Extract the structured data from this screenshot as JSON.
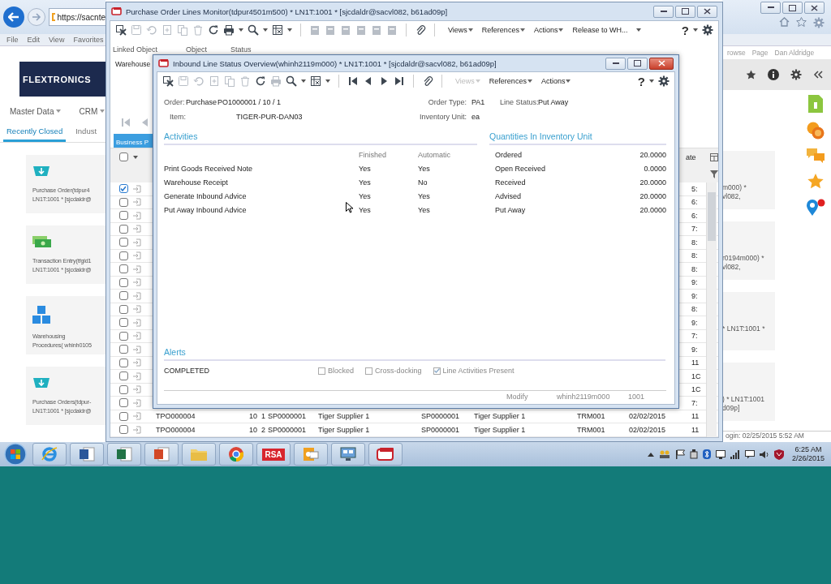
{
  "browser": {
    "address": "https://sacnte",
    "menu": [
      "File",
      "Edit",
      "View",
      "Favorites"
    ],
    "logo": "FLEXTRONICS",
    "nav": [
      "Master Data",
      "CRM"
    ],
    "tabs": [
      {
        "label": "Recently Closed",
        "selected": true
      },
      {
        "label": "Indust",
        "selected": false
      }
    ],
    "cards": [
      {
        "kind": "tray",
        "lines": [
          "Purchase Order(tdpur4",
          "LN1T:1001 * [sjcdaldr@"
        ]
      },
      {
        "kind": "cash",
        "lines": [
          "Transaction Entry(tfgld1",
          "LN1T:1001 * [sjcdaldr@"
        ]
      },
      {
        "kind": "blocks",
        "lines": [
          "Warehousing",
          "Procedures( whinh0105"
        ]
      },
      {
        "kind": "tray",
        "lines": [
          "Purchase Orders(tdpur-",
          "LN1T:1001 * [sjcdaldr@"
        ]
      }
    ],
    "command_bar": [
      "rowse",
      "Page",
      "Dan Aldridge"
    ],
    "right_cards": [
      {
        "lines": [
          "m000) *",
          "vl082,"
        ]
      },
      {
        "lines": [
          "r0194m000) *",
          "vl082,"
        ]
      },
      {
        "lines": [
          "* LN1T:1001 *"
        ]
      },
      {
        "lines": [
          ") * LN1T:1001",
          "d09p]"
        ]
      }
    ],
    "login": "ogin: 02/25/2015 5:52 AM"
  },
  "monitor": {
    "title": "Purchase Order Lines Monitor(tdpur4501m500) * LN1T:1001 * [sjcdaldr@sacvl082, b61ad09p]",
    "menus": [
      {
        "label": "Views",
        "kind": "menu"
      },
      {
        "label": "References",
        "kind": "menu"
      },
      {
        "label": "Actions",
        "kind": "menu"
      },
      {
        "label": "Release to WH...",
        "kind": "split"
      }
    ],
    "help": "?",
    "labels": [
      "Linked Object",
      "Object",
      "Status"
    ],
    "linked_value": "Warehouse",
    "tab": {
      "label": "Business P",
      "selected": true
    },
    "select_all_checked": false,
    "time_header": "ate",
    "rows": [
      {
        "checked": true,
        "time": "5:"
      },
      {
        "checked": false,
        "time": "6:"
      },
      {
        "checked": false,
        "time": "6:"
      },
      {
        "checked": false,
        "time": "7:"
      },
      {
        "checked": false,
        "time": "8:"
      },
      {
        "checked": false,
        "time": "8:"
      },
      {
        "checked": false,
        "time": "8:"
      },
      {
        "checked": false,
        "time": "9:"
      },
      {
        "checked": false,
        "time": "9:"
      },
      {
        "checked": false,
        "time": "8:"
      },
      {
        "checked": false,
        "time": "9:"
      },
      {
        "checked": false,
        "time": "7:"
      },
      {
        "checked": false,
        "time": "9:"
      },
      {
        "checked": false,
        "time": "11"
      },
      {
        "checked": false,
        "time": "1C"
      },
      {
        "checked": false,
        "time": "1C"
      },
      {
        "checked": false,
        "time": "7:"
      },
      {
        "checked": false,
        "time": "11",
        "cells": [
          "TPO000004",
          "10",
          "1",
          "SP0000001",
          "Tiger Supplier 1",
          "SP0000001",
          "Tiger Supplier 1",
          "TRM001",
          "02/02/2015"
        ]
      },
      {
        "checked": false,
        "time": "11",
        "cells": [
          "TPO000004",
          "10",
          "2",
          "SP0000001",
          "Tiger Supplier 1",
          "SP0000001",
          "Tiger Supplier 1",
          "TRM001",
          "02/02/2015"
        ]
      }
    ]
  },
  "dialog": {
    "title": "Inbound Line Status Overview(whinh2119m000) * LN1T:1001 * [sjcdaldr@sacvl082, b61ad09p]",
    "menus": [
      {
        "label": "Views",
        "disabled": true
      },
      {
        "label": "References",
        "disabled": false
      },
      {
        "label": "Actions",
        "disabled": false
      }
    ],
    "help": "?",
    "order": {
      "label": "Order:",
      "kind": "Purchase",
      "value": "PO1000001 / 10 / 1"
    },
    "order_type": {
      "label": "Order Type:",
      "value": "PA1"
    },
    "line_status": {
      "label": "Line Status:",
      "value": "Put Away"
    },
    "item": {
      "label": "Item:",
      "value": "TIGER-PUR-DAN03"
    },
    "inventory_unit": {
      "label": "Inventory Unit:",
      "value": "ea"
    },
    "activities": {
      "title": "Activities",
      "columns": [
        "Finished",
        "Automatic"
      ],
      "rows": [
        {
          "name": "Print Goods Received Note",
          "finished": "Yes",
          "automatic": "Yes"
        },
        {
          "name": "Warehouse Receipt",
          "finished": "Yes",
          "automatic": "No"
        },
        {
          "name": "Generate Inbound Advice",
          "finished": "Yes",
          "automatic": "Yes"
        },
        {
          "name": "Put Away Inbound Advice",
          "finished": "Yes",
          "automatic": "Yes"
        }
      ]
    },
    "quantities": {
      "title": "Quantities In Inventory Unit",
      "rows": [
        {
          "label": "Ordered",
          "value": "20.0000"
        },
        {
          "label": "Open Received",
          "value": "0.0000"
        },
        {
          "label": "Received",
          "value": "20.0000"
        },
        {
          "label": "Advised",
          "value": "20.0000"
        },
        {
          "label": "Put Away",
          "value": "20.0000"
        }
      ]
    },
    "alerts": {
      "title": "Alerts",
      "status": "COMPLETED",
      "checks": [
        {
          "label": "Blocked",
          "checked": false
        },
        {
          "label": "Cross-docking",
          "checked": false
        },
        {
          "label": "Line Activities Present",
          "checked": true
        }
      ]
    },
    "status_bar": [
      "Modify",
      "whinh2119m000",
      "1001"
    ]
  },
  "taskbar": {
    "apps": [
      {
        "kind": "ie"
      },
      {
        "kind": "word"
      },
      {
        "kind": "excel"
      },
      {
        "kind": "powerpoint"
      },
      {
        "kind": "folder"
      },
      {
        "kind": "chrome"
      },
      {
        "kind": "rsa",
        "label": "RSA"
      },
      {
        "kind": "outlook"
      },
      {
        "kind": "monitor"
      },
      {
        "kind": "infor"
      }
    ],
    "time": "6:25 AM",
    "date": "2/26/2015"
  }
}
